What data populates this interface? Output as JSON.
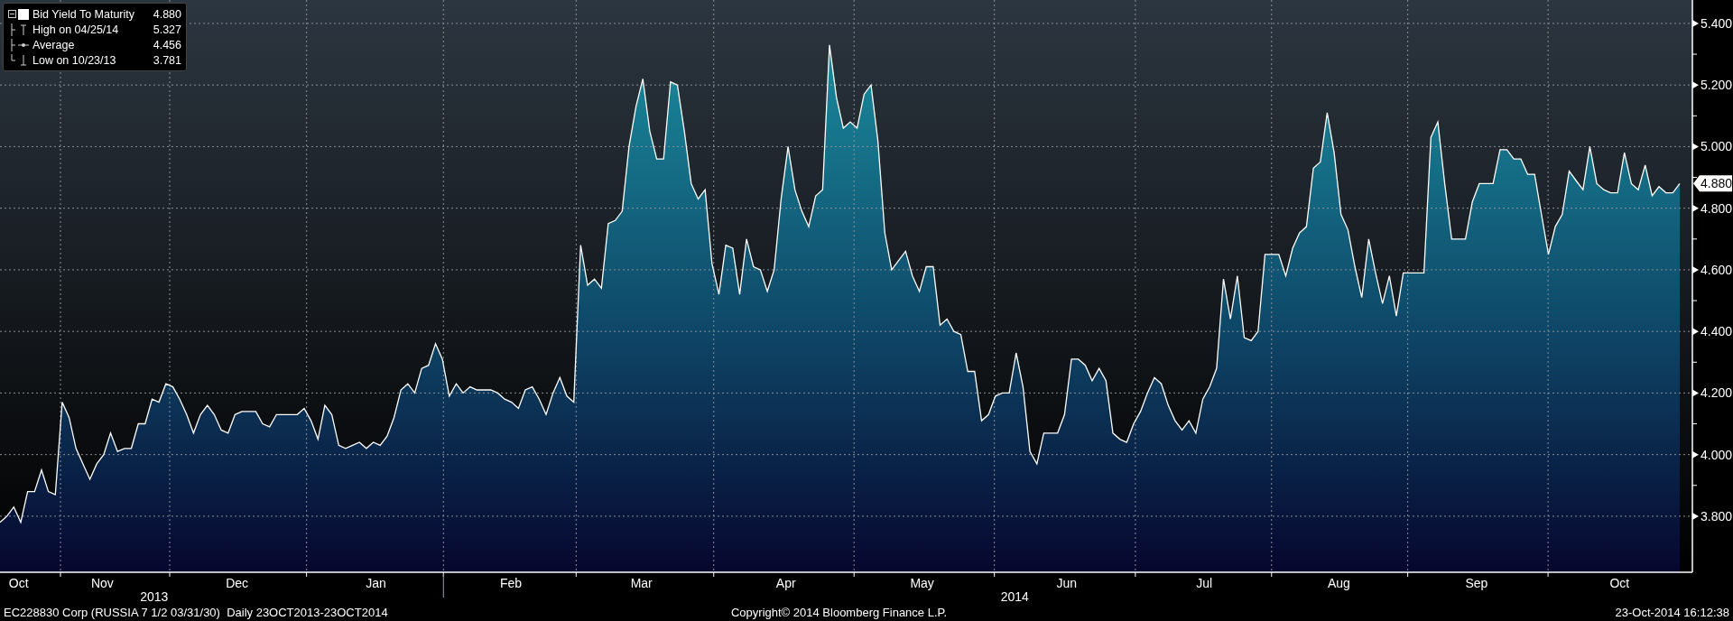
{
  "legend": {
    "collapsed": false,
    "items": [
      {
        "kind": "series",
        "value": "4.880"
      },
      {
        "kind": "high",
        "label": "High on 04/25/14",
        "value": "5.327"
      },
      {
        "kind": "average",
        "label": "Average",
        "value": "4.456"
      },
      {
        "kind": "low",
        "label": "Low on 10/23/13",
        "value": "3.781"
      }
    ]
  },
  "last_value_marker": "4.880",
  "chart_data": {
    "type": "area",
    "ylim": [
      3.618,
      5.476
    ],
    "yticks": [
      {
        "value": 3.8,
        "label": "3.800"
      },
      {
        "value": 4.0,
        "label": "4.000"
      },
      {
        "value": 4.2,
        "label": "4.200"
      },
      {
        "value": 4.4,
        "label": "4.400"
      },
      {
        "value": 4.6,
        "label": "4.600"
      },
      {
        "value": 4.8,
        "label": "4.800"
      },
      {
        "value": 5.0,
        "label": "5.000"
      },
      {
        "value": 5.2,
        "label": "5.200"
      },
      {
        "value": 5.4,
        "label": "5.400"
      }
    ],
    "grid": true,
    "series": [
      {
        "name": "Bid Yield To Maturity",
        "color": "#ffffff",
        "values": [
          3.78,
          3.8,
          3.83,
          3.78,
          3.88,
          3.88,
          3.95,
          3.88,
          3.87,
          4.17,
          4.12,
          4.02,
          3.97,
          3.92,
          3.97,
          4.0,
          4.07,
          4.01,
          4.02,
          4.02,
          4.1,
          4.1,
          4.18,
          4.17,
          4.23,
          4.22,
          4.18,
          4.13,
          4.07,
          4.13,
          4.16,
          4.13,
          4.08,
          4.07,
          4.13,
          4.14,
          4.14,
          4.14,
          4.1,
          4.09,
          4.13,
          4.13,
          4.13,
          4.13,
          4.15,
          4.11,
          4.05,
          4.16,
          4.13,
          4.03,
          4.02,
          4.03,
          4.04,
          4.02,
          4.04,
          4.03,
          4.06,
          4.12,
          4.21,
          4.23,
          4.2,
          4.28,
          4.29,
          4.36,
          4.31,
          4.19,
          4.23,
          4.2,
          4.22,
          4.21,
          4.21,
          4.21,
          4.2,
          4.18,
          4.17,
          4.15,
          4.21,
          4.22,
          4.18,
          4.13,
          4.2,
          4.25,
          4.19,
          4.17,
          4.68,
          4.55,
          4.57,
          4.54,
          4.75,
          4.76,
          4.79,
          5.0,
          5.13,
          5.22,
          5.05,
          4.96,
          4.96,
          5.21,
          5.2,
          5.05,
          4.88,
          4.83,
          4.86,
          4.62,
          4.52,
          4.68,
          4.67,
          4.52,
          4.7,
          4.61,
          4.6,
          4.53,
          4.6,
          4.83,
          5.0,
          4.86,
          4.79,
          4.74,
          4.84,
          4.86,
          5.33,
          5.16,
          5.06,
          5.08,
          5.06,
          5.17,
          5.2,
          5.02,
          4.72,
          4.6,
          4.63,
          4.66,
          4.58,
          4.53,
          4.61,
          4.61,
          4.42,
          4.44,
          4.4,
          4.39,
          4.27,
          4.27,
          4.11,
          4.13,
          4.19,
          4.2,
          4.2,
          4.33,
          4.22,
          4.01,
          3.97,
          4.07,
          4.07,
          4.07,
          4.13,
          4.31,
          4.31,
          4.29,
          4.24,
          4.28,
          4.24,
          4.07,
          4.05,
          4.04,
          4.1,
          4.14,
          4.2,
          4.25,
          4.23,
          4.16,
          4.11,
          4.08,
          4.11,
          4.07,
          4.18,
          4.22,
          4.28,
          4.57,
          4.44,
          4.58,
          4.38,
          4.37,
          4.4,
          4.65,
          4.65,
          4.65,
          4.58,
          4.67,
          4.72,
          4.74,
          4.93,
          4.95,
          5.11,
          4.98,
          4.78,
          4.73,
          4.61,
          4.51,
          4.7,
          4.59,
          4.49,
          4.58,
          4.45,
          4.59,
          4.59,
          4.59,
          4.59,
          5.03,
          5.08,
          4.88,
          4.7,
          4.7,
          4.7,
          4.82,
          4.88,
          4.88,
          4.88,
          4.99,
          4.99,
          4.96,
          4.96,
          4.91,
          4.91,
          4.78,
          4.65,
          4.74,
          4.78,
          4.92,
          4.89,
          4.86,
          5.0,
          4.88,
          4.86,
          4.85,
          4.85,
          4.98,
          4.88,
          4.86,
          4.94,
          4.84,
          4.87,
          4.85,
          4.85,
          4.88
        ]
      }
    ]
  },
  "x_axis": {
    "months": [
      "Oct",
      "Nov",
      "Dec",
      "Jan",
      "Feb",
      "Mar",
      "Apr",
      "May",
      "Jun",
      "Jul",
      "Aug",
      "Sep",
      "Oct"
    ],
    "years": [
      "2013",
      "2014"
    ]
  },
  "footer": {
    "security": "EC228830 Corp (RUSSIA 7 1/2 03/31/30)  Daily 23OCT2013-23OCT2014",
    "copyright": "Copyright© 2014 Bloomberg Finance L.P.",
    "timestamp": "23-Oct-2014 16:12:38"
  }
}
